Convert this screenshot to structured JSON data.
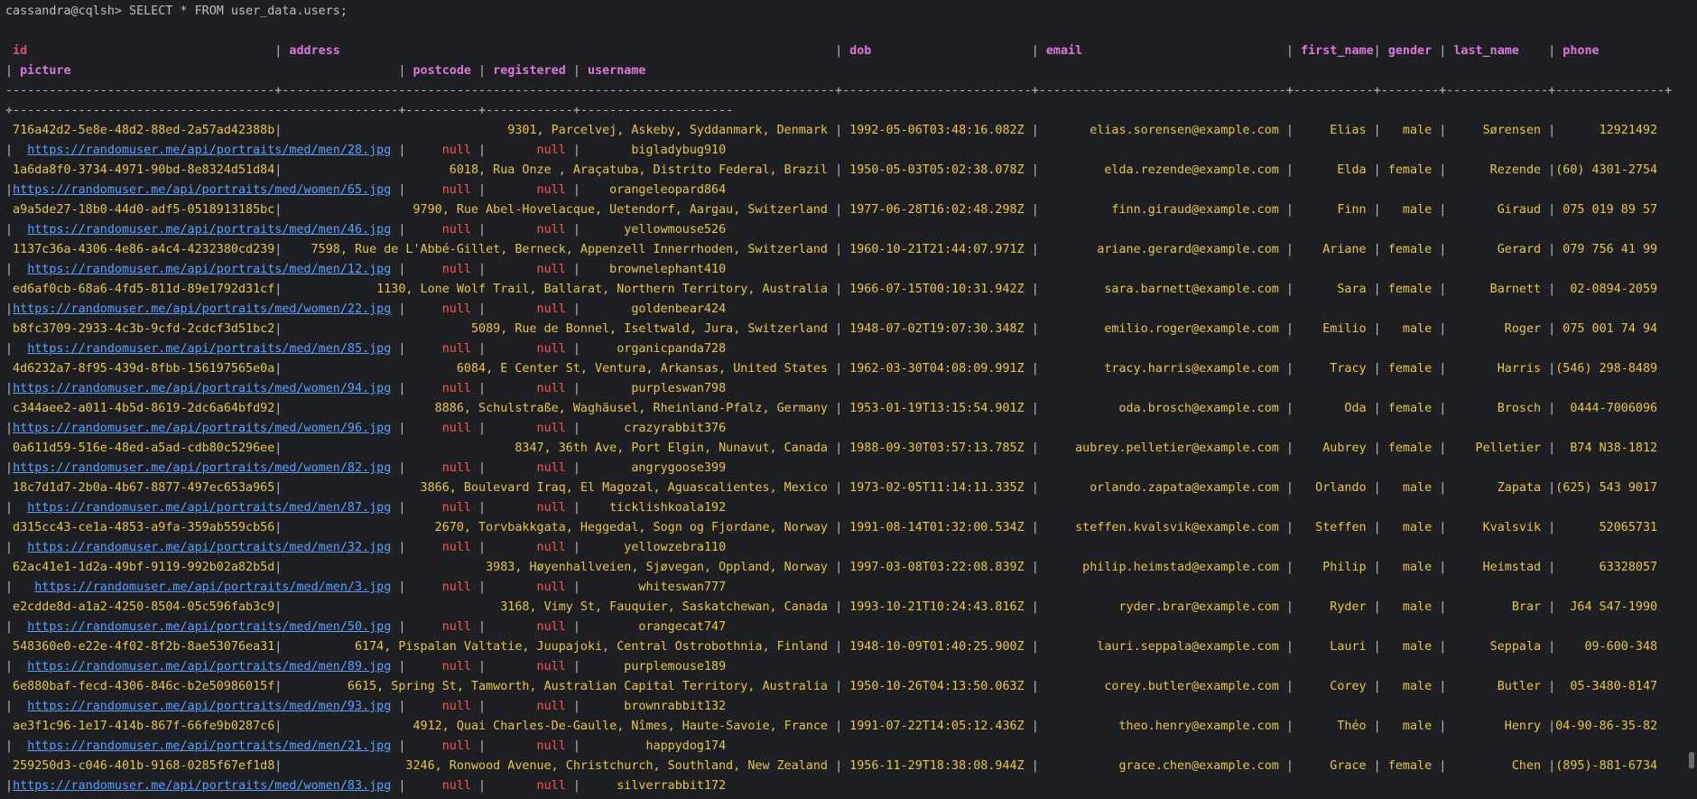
{
  "prompt": "cassandra@cqlsh> SELECT * FROM user_data.users;",
  "headers": {
    "id": "id",
    "address": "address",
    "dob": "dob",
    "email": "email",
    "first_name": "first_name",
    "gender": "gender",
    "last_name": "last_name",
    "phone": "phone",
    "picture": "picture",
    "postcode": "postcode",
    "registered": "registered",
    "username": "username"
  },
  "rows": [
    {
      "id": "716a42d2-5e8e-48d2-88ed-2a57ad42388b",
      "address": "9301, Parcelvej, Askeby, Syddanmark, Denmark",
      "dob": "1992-05-06T03:48:16.082Z",
      "email": "elias.sorensen@example.com",
      "first_name": "Elias",
      "gender": "male",
      "last_name": "Sørensen",
      "phone": "12921492",
      "picture": "https://randomuser.me/api/portraits/med/men/28.jpg",
      "postcode": "null",
      "registered": "null",
      "username": "bigladybug910"
    },
    {
      "id": "1a6da8f0-3734-4971-90bd-8e8324d51d84",
      "address": "6018, Rua Onze , Araçatuba, Distrito Federal, Brazil",
      "dob": "1950-05-03T05:02:38.078Z",
      "email": "elda.rezende@example.com",
      "first_name": "Elda",
      "gender": "female",
      "last_name": "Rezende",
      "phone": "(60) 4301-2754",
      "picture": "https://randomuser.me/api/portraits/med/women/65.jpg",
      "postcode": "null",
      "registered": "null",
      "username": "orangeleopard864"
    },
    {
      "id": "a9a5de27-18b0-44d0-adf5-0518913185bc",
      "address": "9790, Rue Abel-Hovelacque, Uetendorf, Aargau, Switzerland",
      "dob": "1977-06-28T16:02:48.298Z",
      "email": "finn.giraud@example.com",
      "first_name": "Finn",
      "gender": "male",
      "last_name": "Giraud",
      "phone": "075 019 89 57",
      "picture": "https://randomuser.me/api/portraits/med/men/46.jpg",
      "postcode": "null",
      "registered": "null",
      "username": "yellowmouse526"
    },
    {
      "id": "1137c36a-4306-4e86-a4c4-4232380cd239",
      "address": "7598, Rue de L'Abbé-Gillet, Berneck, Appenzell Innerrhoden, Switzerland",
      "dob": "1960-10-21T21:44:07.971Z",
      "email": "ariane.gerard@example.com",
      "first_name": "Ariane",
      "gender": "female",
      "last_name": "Gerard",
      "phone": "079 756 41 99",
      "picture": "https://randomuser.me/api/portraits/med/men/12.jpg",
      "postcode": "null",
      "registered": "null",
      "username": "brownelephant410"
    },
    {
      "id": "ed6af0cb-68a6-4fd5-811d-89e1792d31cf",
      "address": "1130, Lone Wolf Trail, Ballarat, Northern Territory, Australia",
      "dob": "1966-07-15T00:10:31.942Z",
      "email": "sara.barnett@example.com",
      "first_name": "Sara",
      "gender": "female",
      "last_name": "Barnett",
      "phone": "02-0894-2059",
      "picture": "https://randomuser.me/api/portraits/med/women/22.jpg",
      "postcode": "null",
      "registered": "null",
      "username": "goldenbear424"
    },
    {
      "id": "b8fc3709-2933-4c3b-9cfd-2cdcf3d51bc2",
      "address": "5089, Rue de Bonnel, Iseltwald, Jura, Switzerland",
      "dob": "1948-07-02T19:07:30.348Z",
      "email": "emilio.roger@example.com",
      "first_name": "Emilio",
      "gender": "male",
      "last_name": "Roger",
      "phone": "075 001 74 94",
      "picture": "https://randomuser.me/api/portraits/med/men/85.jpg",
      "postcode": "null",
      "registered": "null",
      "username": "organicpanda728"
    },
    {
      "id": "4d6232a7-8f95-439d-8fbb-156197565e0a",
      "address": "6084, E Center St, Ventura, Arkansas, United States",
      "dob": "1962-03-30T04:08:09.991Z",
      "email": "tracy.harris@example.com",
      "first_name": "Tracy",
      "gender": "female",
      "last_name": "Harris",
      "phone": "(546) 298-8489",
      "picture": "https://randomuser.me/api/portraits/med/women/94.jpg",
      "postcode": "null",
      "registered": "null",
      "username": "purpleswan798"
    },
    {
      "id": "c344aee2-a011-4b5d-8619-2dc6a64bfd92",
      "address": "8886, Schulstraße, Waghäusel, Rheinland-Pfalz, Germany",
      "dob": "1953-01-19T13:15:54.901Z",
      "email": "oda.brosch@example.com",
      "first_name": "Oda",
      "gender": "female",
      "last_name": "Brosch",
      "phone": "0444-7006096",
      "picture": "https://randomuser.me/api/portraits/med/women/96.jpg",
      "postcode": "null",
      "registered": "null",
      "username": "crazyrabbit376"
    },
    {
      "id": "0a611d59-516e-48ed-a5ad-cdb80c5296ee",
      "address": "8347, 36th Ave, Port Elgin, Nunavut, Canada",
      "dob": "1988-09-30T03:57:13.785Z",
      "email": "aubrey.pelletier@example.com",
      "first_name": "Aubrey",
      "gender": "female",
      "last_name": "Pelletier",
      "phone": "B74 N38-1812",
      "picture": "https://randomuser.me/api/portraits/med/women/82.jpg",
      "postcode": "null",
      "registered": "null",
      "username": "angrygoose399"
    },
    {
      "id": "18c7d1d7-2b0a-4b67-8877-497ec653a965",
      "address": "3866, Boulevard Iraq, El Magozal, Aguascalientes, Mexico",
      "dob": "1973-02-05T11:14:11.335Z",
      "email": "orlando.zapata@example.com",
      "first_name": "Orlando",
      "gender": "male",
      "last_name": "Zapata",
      "phone": "(625) 543 9017",
      "picture": "https://randomuser.me/api/portraits/med/men/87.jpg",
      "postcode": "null",
      "registered": "null",
      "username": "ticklishkoala192"
    },
    {
      "id": "d315cc43-ce1a-4853-a9fa-359ab559cb56",
      "address": "2670, Torvbakkgata, Heggedal, Sogn og Fjordane, Norway",
      "dob": "1991-08-14T01:32:00.534Z",
      "email": "steffen.kvalsvik@example.com",
      "first_name": "Steffen",
      "gender": "male",
      "last_name": "Kvalsvik",
      "phone": "52065731",
      "picture": "https://randomuser.me/api/portraits/med/men/32.jpg",
      "postcode": "null",
      "registered": "null",
      "username": "yellowzebra110"
    },
    {
      "id": "62ac41e1-1d2a-49bf-9119-992b02a82b5d",
      "address": "3983, Høyenhallveien, Sjøvegan, Oppland, Norway",
      "dob": "1997-03-08T03:22:08.839Z",
      "email": "philip.heimstad@example.com",
      "first_name": "Philip",
      "gender": "male",
      "last_name": "Heimstad",
      "phone": "63328057",
      "picture": "https://randomuser.me/api/portraits/med/men/3.jpg",
      "postcode": "null",
      "registered": "null",
      "username": "whiteswan777"
    },
    {
      "id": "e2cdde8d-a1a2-4250-8504-05c596fab3c9",
      "address": "3168, Vimy St, Fauquier, Saskatchewan, Canada",
      "dob": "1993-10-21T10:24:43.816Z",
      "email": "ryder.brar@example.com",
      "first_name": "Ryder",
      "gender": "male",
      "last_name": "Brar",
      "phone": "J64 S47-1990",
      "picture": "https://randomuser.me/api/portraits/med/men/50.jpg",
      "postcode": "null",
      "registered": "null",
      "username": "orangecat747"
    },
    {
      "id": "548360e0-e22e-4f02-8f2b-8ae53076ea31",
      "address": "6174, Pispalan Valtatie, Juupajoki, Central Ostrobothnia, Finland",
      "dob": "1948-10-09T01:40:25.900Z",
      "email": "lauri.seppala@example.com",
      "first_name": "Lauri",
      "gender": "male",
      "last_name": "Seppala",
      "phone": "09-600-348",
      "picture": "https://randomuser.me/api/portraits/med/men/89.jpg",
      "postcode": "null",
      "registered": "null",
      "username": "purplemouse189"
    },
    {
      "id": "6e880baf-fecd-4306-846c-b2e50986015f",
      "address": "6615, Spring St, Tamworth, Australian Capital Territory, Australia",
      "dob": "1950-10-26T04:13:50.063Z",
      "email": "corey.butler@example.com",
      "first_name": "Corey",
      "gender": "male",
      "last_name": "Butler",
      "phone": "05-3480-8147",
      "picture": "https://randomuser.me/api/portraits/med/men/93.jpg",
      "postcode": "null",
      "registered": "null",
      "username": "brownrabbit132"
    },
    {
      "id": "ae3f1c96-1e17-414b-867f-66fe9b0287c6",
      "address": "4912, Quai Charles-De-Gaulle, Nîmes, Haute-Savoie, France",
      "dob": "1991-07-22T14:05:12.436Z",
      "email": "theo.henry@example.com",
      "first_name": "Théo",
      "gender": "male",
      "last_name": "Henry",
      "phone": "04-90-86-35-82",
      "picture": "https://randomuser.me/api/portraits/med/men/21.jpg",
      "postcode": "null",
      "registered": "null",
      "username": "happydog174"
    },
    {
      "id": "259250d3-c046-401b-9168-0285f67ef1d8",
      "address": "3246, Ronwood Avenue, Christchurch, Southland, New Zealand",
      "dob": "1956-11-29T18:38:08.944Z",
      "email": "grace.chen@example.com",
      "first_name": "Grace",
      "gender": "female",
      "last_name": "Chen",
      "phone": "(895)-881-6734",
      "picture": "https://randomuser.me/api/portraits/med/women/83.jpg",
      "postcode": "null",
      "registered": "null",
      "username": "silverrabbit172"
    }
  ]
}
